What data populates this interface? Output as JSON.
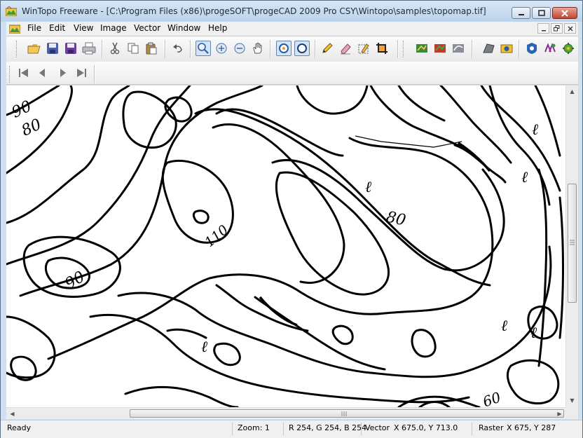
{
  "window": {
    "title": "WinTopo Freeware - [C:\\Program Files (x86)\\progeSOFT\\progeCAD 2009 Pro CSY\\Wintopo\\samples\\topomap.tif]"
  },
  "menu": {
    "items": [
      "File",
      "Edit",
      "View",
      "Image",
      "Vector",
      "Window",
      "Help"
    ]
  },
  "toolbar": {
    "icons": [
      "open-icon",
      "save-icon",
      "save-as-icon",
      "print-icon",
      "cut-icon",
      "copy-icon",
      "paste-icon",
      "undo-icon",
      "zoom-select-icon",
      "zoom-in-icon",
      "zoom-out-icon",
      "pan-hand-icon",
      "raster-view-icon",
      "vector-view-icon",
      "pencil-icon",
      "eraser-icon",
      "edit-node-icon",
      "crop-icon",
      "thin-icon",
      "auto-trace-icon",
      "smooth-icon",
      "one-touch-icon",
      "tracing-options-icon",
      "vectorize-icon",
      "layers-icon",
      "settings-icon"
    ]
  },
  "playback": {
    "icons": [
      "first-frame-icon",
      "prev-frame-icon",
      "next-frame-icon",
      "last-frame-icon"
    ]
  },
  "map": {
    "labels": [
      "90",
      "80",
      "ℓ",
      "ℓ",
      "ℓ",
      "80",
      "110",
      "90",
      "ℓ",
      "ℓ",
      "ℓ",
      "60"
    ]
  },
  "status": {
    "state": "Ready",
    "zoom": "Zoom: 1",
    "rgb": "R 254, G 254, B 254",
    "vector_label": "Vector",
    "vector_coords": "X 675.0, Y 713.0",
    "raster_label": "Raster",
    "raster_coords": "X 675, Y 287"
  },
  "colors": {
    "accent": "#3b6ea5",
    "close": "#c14530"
  }
}
